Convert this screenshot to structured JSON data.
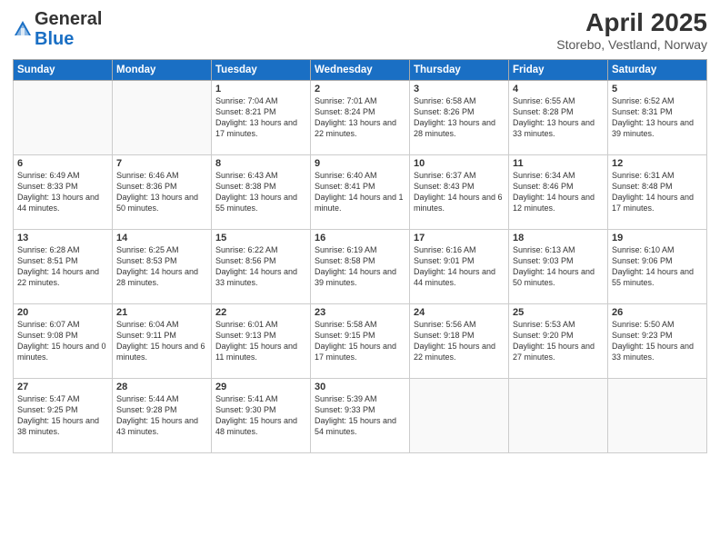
{
  "logo": {
    "general": "General",
    "blue": "Blue"
  },
  "title": "April 2025",
  "subtitle": "Storebo, Vestland, Norway",
  "days_of_week": [
    "Sunday",
    "Monday",
    "Tuesday",
    "Wednesday",
    "Thursday",
    "Friday",
    "Saturday"
  ],
  "weeks": [
    [
      {
        "day": "",
        "info": ""
      },
      {
        "day": "",
        "info": ""
      },
      {
        "day": "1",
        "info": "Sunrise: 7:04 AM\nSunset: 8:21 PM\nDaylight: 13 hours and 17 minutes."
      },
      {
        "day": "2",
        "info": "Sunrise: 7:01 AM\nSunset: 8:24 PM\nDaylight: 13 hours and 22 minutes."
      },
      {
        "day": "3",
        "info": "Sunrise: 6:58 AM\nSunset: 8:26 PM\nDaylight: 13 hours and 28 minutes."
      },
      {
        "day": "4",
        "info": "Sunrise: 6:55 AM\nSunset: 8:28 PM\nDaylight: 13 hours and 33 minutes."
      },
      {
        "day": "5",
        "info": "Sunrise: 6:52 AM\nSunset: 8:31 PM\nDaylight: 13 hours and 39 minutes."
      }
    ],
    [
      {
        "day": "6",
        "info": "Sunrise: 6:49 AM\nSunset: 8:33 PM\nDaylight: 13 hours and 44 minutes."
      },
      {
        "day": "7",
        "info": "Sunrise: 6:46 AM\nSunset: 8:36 PM\nDaylight: 13 hours and 50 minutes."
      },
      {
        "day": "8",
        "info": "Sunrise: 6:43 AM\nSunset: 8:38 PM\nDaylight: 13 hours and 55 minutes."
      },
      {
        "day": "9",
        "info": "Sunrise: 6:40 AM\nSunset: 8:41 PM\nDaylight: 14 hours and 1 minute."
      },
      {
        "day": "10",
        "info": "Sunrise: 6:37 AM\nSunset: 8:43 PM\nDaylight: 14 hours and 6 minutes."
      },
      {
        "day": "11",
        "info": "Sunrise: 6:34 AM\nSunset: 8:46 PM\nDaylight: 14 hours and 12 minutes."
      },
      {
        "day": "12",
        "info": "Sunrise: 6:31 AM\nSunset: 8:48 PM\nDaylight: 14 hours and 17 minutes."
      }
    ],
    [
      {
        "day": "13",
        "info": "Sunrise: 6:28 AM\nSunset: 8:51 PM\nDaylight: 14 hours and 22 minutes."
      },
      {
        "day": "14",
        "info": "Sunrise: 6:25 AM\nSunset: 8:53 PM\nDaylight: 14 hours and 28 minutes."
      },
      {
        "day": "15",
        "info": "Sunrise: 6:22 AM\nSunset: 8:56 PM\nDaylight: 14 hours and 33 minutes."
      },
      {
        "day": "16",
        "info": "Sunrise: 6:19 AM\nSunset: 8:58 PM\nDaylight: 14 hours and 39 minutes."
      },
      {
        "day": "17",
        "info": "Sunrise: 6:16 AM\nSunset: 9:01 PM\nDaylight: 14 hours and 44 minutes."
      },
      {
        "day": "18",
        "info": "Sunrise: 6:13 AM\nSunset: 9:03 PM\nDaylight: 14 hours and 50 minutes."
      },
      {
        "day": "19",
        "info": "Sunrise: 6:10 AM\nSunset: 9:06 PM\nDaylight: 14 hours and 55 minutes."
      }
    ],
    [
      {
        "day": "20",
        "info": "Sunrise: 6:07 AM\nSunset: 9:08 PM\nDaylight: 15 hours and 0 minutes."
      },
      {
        "day": "21",
        "info": "Sunrise: 6:04 AM\nSunset: 9:11 PM\nDaylight: 15 hours and 6 minutes."
      },
      {
        "day": "22",
        "info": "Sunrise: 6:01 AM\nSunset: 9:13 PM\nDaylight: 15 hours and 11 minutes."
      },
      {
        "day": "23",
        "info": "Sunrise: 5:58 AM\nSunset: 9:15 PM\nDaylight: 15 hours and 17 minutes."
      },
      {
        "day": "24",
        "info": "Sunrise: 5:56 AM\nSunset: 9:18 PM\nDaylight: 15 hours and 22 minutes."
      },
      {
        "day": "25",
        "info": "Sunrise: 5:53 AM\nSunset: 9:20 PM\nDaylight: 15 hours and 27 minutes."
      },
      {
        "day": "26",
        "info": "Sunrise: 5:50 AM\nSunset: 9:23 PM\nDaylight: 15 hours and 33 minutes."
      }
    ],
    [
      {
        "day": "27",
        "info": "Sunrise: 5:47 AM\nSunset: 9:25 PM\nDaylight: 15 hours and 38 minutes."
      },
      {
        "day": "28",
        "info": "Sunrise: 5:44 AM\nSunset: 9:28 PM\nDaylight: 15 hours and 43 minutes."
      },
      {
        "day": "29",
        "info": "Sunrise: 5:41 AM\nSunset: 9:30 PM\nDaylight: 15 hours and 48 minutes."
      },
      {
        "day": "30",
        "info": "Sunrise: 5:39 AM\nSunset: 9:33 PM\nDaylight: 15 hours and 54 minutes."
      },
      {
        "day": "",
        "info": ""
      },
      {
        "day": "",
        "info": ""
      },
      {
        "day": "",
        "info": ""
      }
    ]
  ]
}
